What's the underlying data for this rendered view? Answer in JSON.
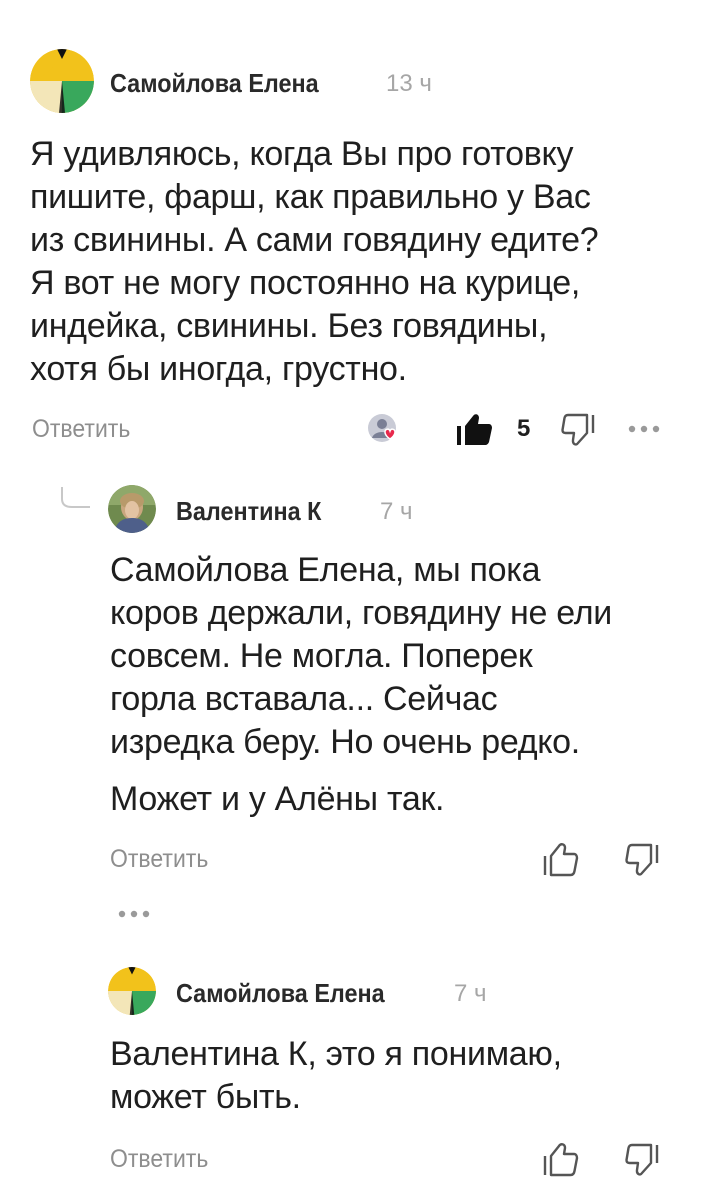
{
  "comments": [
    {
      "author": "Самойлова Елена",
      "time": "13 ч",
      "avatar_icon": "zen-avatar-icon",
      "text_lines": [
        "Я удивляюсь, когда Вы про готовку",
        "пишите, фарш, как правильно у Вас",
        "из свинины. А сами говядину едите?",
        "Я вот не могу постоянно на курице,",
        "индейка, свинины. Без говядины,",
        "хотя бы иногда, грустно."
      ],
      "reply_label": "Ответить",
      "likes_count": "5",
      "liked": true,
      "reaction_icon": "author-reaction-heart-icon"
    },
    {
      "author": "Валентина К",
      "time": "7 ч",
      "avatar_icon": "user-photo-avatar",
      "text_lines": [
        "Самойлова Елена, мы пока",
        "коров держали, говядину не ели",
        "совсем. Не могла. Поперек",
        "горла вставала... Сейчас",
        "изредка беру. Но очень редко."
      ],
      "extra_line": "Может и у Алёны так.",
      "reply_label": "Ответить"
    },
    {
      "author": "Самойлова Елена",
      "time": "7 ч",
      "avatar_icon": "zen-avatar-icon",
      "text_lines": [
        "Валентина К, это я понимаю,",
        "может быть."
      ],
      "reply_label": "Ответить"
    }
  ],
  "colors": {
    "avatar_yellow": "#F2C21B",
    "avatar_cream": "#F3E6B8",
    "avatar_green": "#39A85C",
    "muted_text": "#8E8E8E",
    "body_text": "#1F1F1F"
  }
}
